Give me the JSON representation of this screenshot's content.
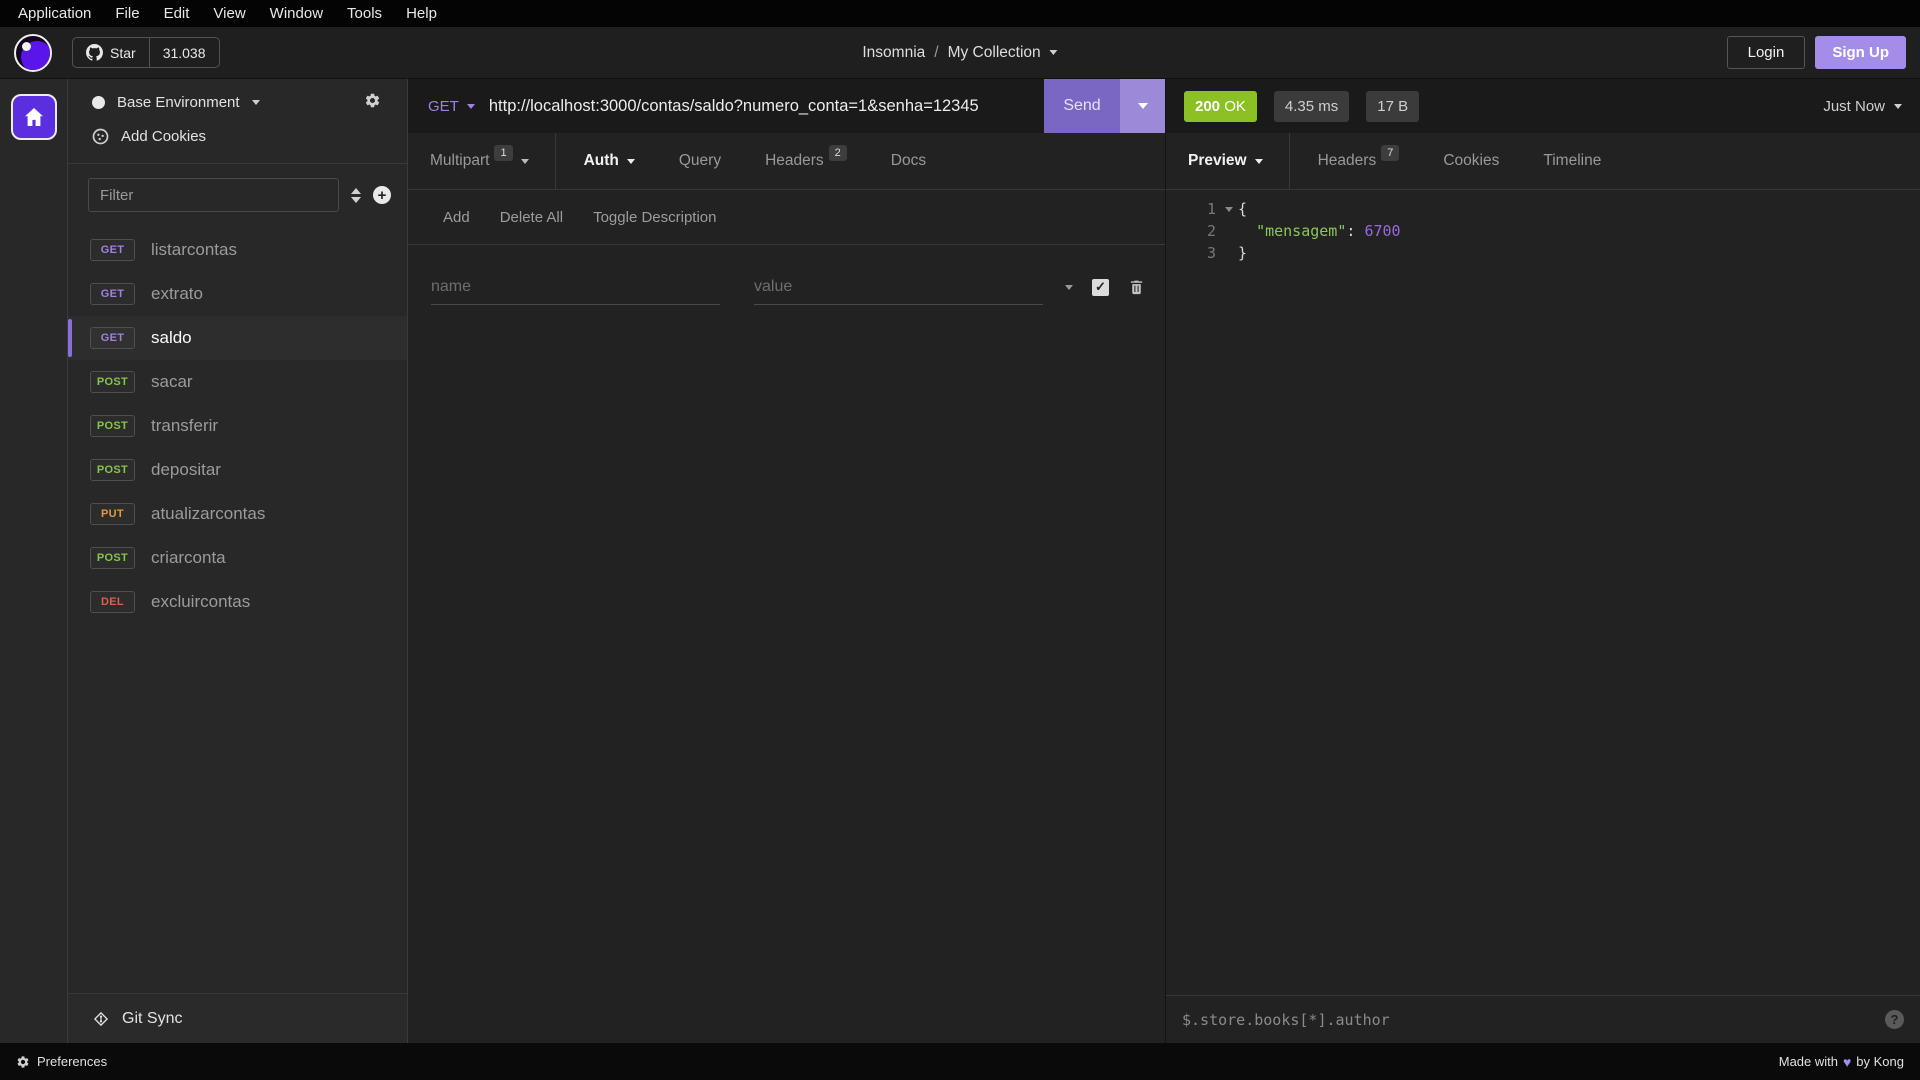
{
  "menu_bar": {
    "items": [
      "Application",
      "File",
      "Edit",
      "View",
      "Window",
      "Tools",
      "Help"
    ]
  },
  "header": {
    "star_label": "Star",
    "star_count": "31.038",
    "app_name": "Insomnia",
    "breadcrumb_separator": "/",
    "collection_name": "My Collection",
    "login_label": "Login",
    "signup_label": "Sign Up"
  },
  "sidebar": {
    "environment_label": "Base Environment",
    "add_cookies_label": "Add Cookies",
    "filter_placeholder": "Filter",
    "requests": [
      {
        "method": "GET",
        "name": "listarcontas",
        "selected": false
      },
      {
        "method": "GET",
        "name": "extrato",
        "selected": false
      },
      {
        "method": "GET",
        "name": "saldo",
        "selected": true
      },
      {
        "method": "POST",
        "name": "sacar",
        "selected": false
      },
      {
        "method": "POST",
        "name": "transferir",
        "selected": false
      },
      {
        "method": "POST",
        "name": "depositar",
        "selected": false
      },
      {
        "method": "PUT",
        "name": "atualizarcontas",
        "selected": false
      },
      {
        "method": "POST",
        "name": "criarconta",
        "selected": false
      },
      {
        "method": "DEL",
        "name": "excluircontas",
        "selected": false
      }
    ],
    "git_sync_label": "Git Sync"
  },
  "request_pane": {
    "method": "GET",
    "url": "http://localhost:3000/contas/saldo?numero_conta=1&senha=12345",
    "send_label": "Send",
    "tabs": [
      {
        "label": "Multipart",
        "badge": "1",
        "dropdown": true,
        "active": false,
        "divided": true
      },
      {
        "label": "Auth",
        "badge": "",
        "dropdown": true,
        "active": true,
        "divided": false
      },
      {
        "label": "Query",
        "badge": "",
        "dropdown": false,
        "active": false,
        "divided": false
      },
      {
        "label": "Headers",
        "badge": "2",
        "dropdown": false,
        "active": false,
        "divided": false
      },
      {
        "label": "Docs",
        "badge": "",
        "dropdown": false,
        "active": false,
        "divided": false
      }
    ],
    "toolbar": {
      "add": "Add",
      "delete_all": "Delete All",
      "toggle_description": "Toggle Description"
    },
    "form_row": {
      "name_placeholder": "name",
      "value_placeholder": "value"
    }
  },
  "response_pane": {
    "status_code": "200",
    "status_text": "OK",
    "time": "4.35 ms",
    "size": "17 B",
    "timestamp": "Just Now",
    "tabs": [
      {
        "label": "Preview",
        "badge": "",
        "dropdown": true,
        "active": true,
        "divided": true
      },
      {
        "label": "Headers",
        "badge": "7",
        "dropdown": false,
        "active": false,
        "divided": false
      },
      {
        "label": "Cookies",
        "badge": "",
        "dropdown": false,
        "active": false,
        "divided": false
      },
      {
        "label": "Timeline",
        "badge": "",
        "dropdown": false,
        "active": false,
        "divided": false
      }
    ],
    "body": {
      "line1_num": "1",
      "line1_open": "{",
      "line2_num": "2",
      "line2_key": "\"mensagem\"",
      "line2_sep": ":",
      "line2_value": "6700",
      "line3_num": "3",
      "line3_close": "}"
    },
    "filter_placeholder": "$.store.books[*].author"
  },
  "status_bar": {
    "preferences_label": "Preferences",
    "made_with": "Made with",
    "heart_icon": "♥",
    "by": "by Kong"
  },
  "colors": {
    "accent_purple": "#7a66c3",
    "signup_purple": "#a48de8",
    "status_green": "#8bc125",
    "methods": {
      "GET": "#a081e0",
      "POST": "#84c54a",
      "PUT": "#e09940",
      "DEL": "#dd5f4c"
    }
  }
}
